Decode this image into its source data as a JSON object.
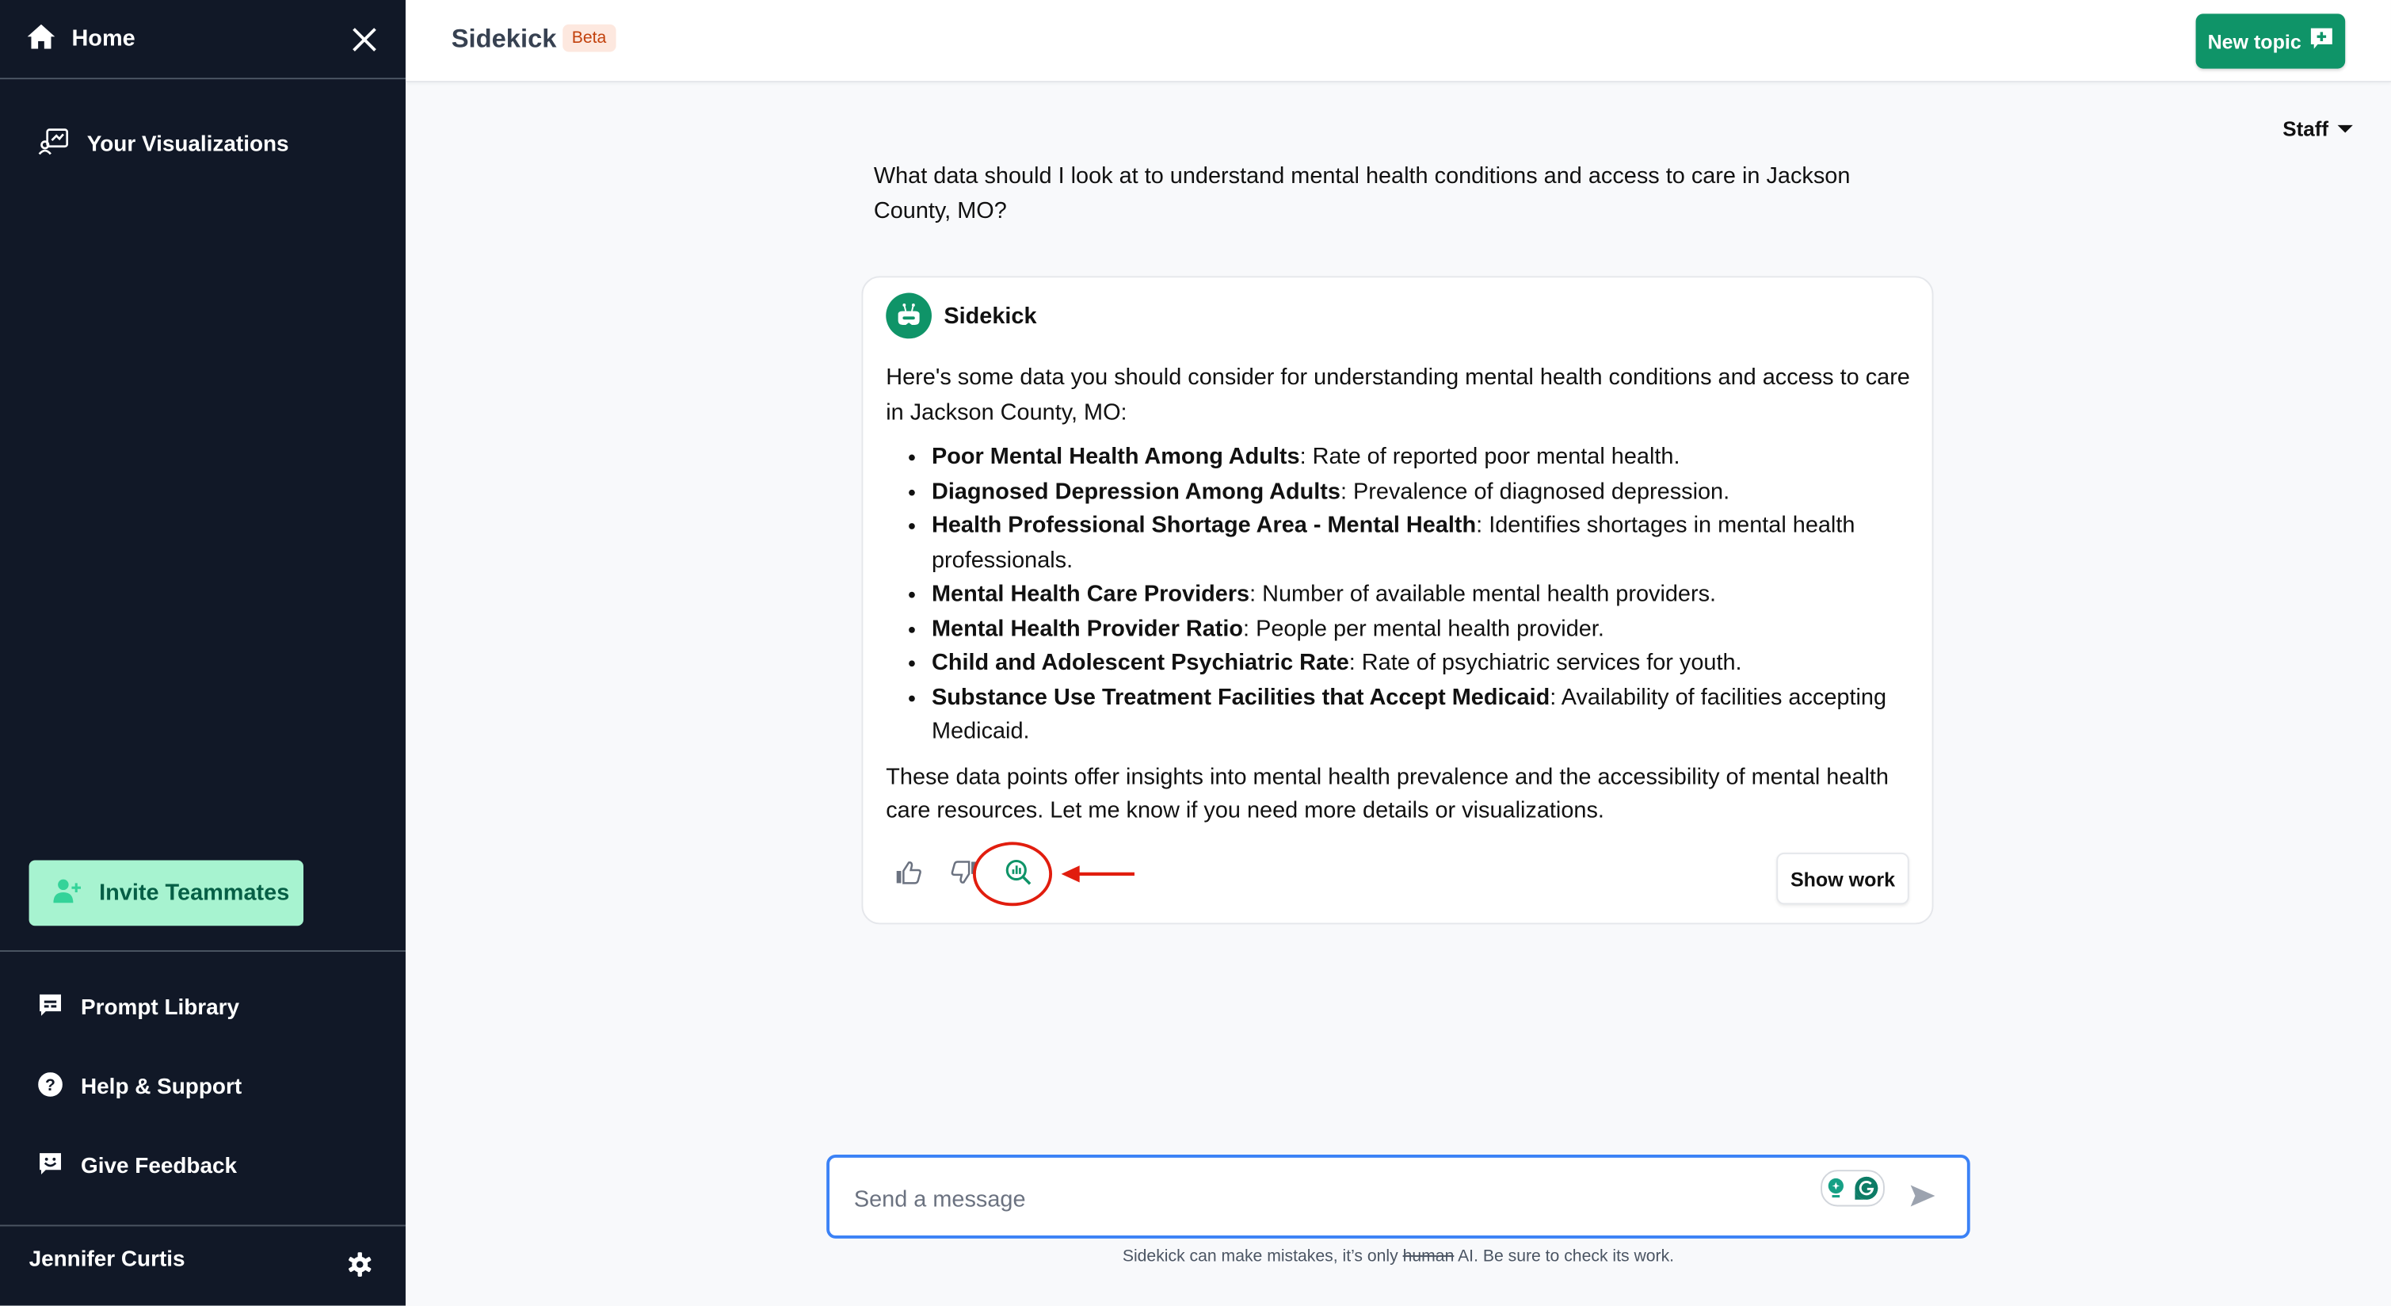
{
  "sidebar": {
    "home_label": "Home",
    "items": [
      {
        "label": "Your Visualizations",
        "icon": "visualizations-icon"
      }
    ],
    "invite_label": "Invite Teammates",
    "footer_items": [
      {
        "label": "Prompt Library",
        "icon": "prompt-library-icon"
      },
      {
        "label": "Help & Support",
        "icon": "help-icon"
      },
      {
        "label": "Give Feedback",
        "icon": "feedback-icon"
      }
    ],
    "user_name": "Jennifer Curtis"
  },
  "header": {
    "title": "Sidekick",
    "badge": "Beta",
    "new_topic_label": "New topic"
  },
  "role_selector": {
    "selected": "Staff"
  },
  "conversation": {
    "user_question": "What data should I look at to understand mental health conditions and access to care in Jackson County, MO?",
    "response": {
      "author": "Sidekick",
      "intro": "Here's some data you should consider for understanding mental health conditions and access to care in Jackson County, MO:",
      "items": [
        {
          "term": "Poor Mental Health Among Adults",
          "desc": ": Rate of reported poor mental health."
        },
        {
          "term": "Diagnosed Depression Among Adults",
          "desc": ": Prevalence of diagnosed depression."
        },
        {
          "term": "Health Professional Shortage Area - Mental Health",
          "desc": ": Identifies shortages in mental health professionals."
        },
        {
          "term": "Mental Health Care Providers",
          "desc": ": Number of available mental health providers."
        },
        {
          "term": "Mental Health Provider Ratio",
          "desc": ": People per mental health provider."
        },
        {
          "term": "Child and Adolescent Psychiatric Rate",
          "desc": ": Rate of psychiatric services for youth."
        },
        {
          "term": "Substance Use Treatment Facilities that Accept Medicaid",
          "desc": ": Availability of facilities accepting Medicaid."
        }
      ],
      "outro": "These data points offer insights into mental health prevalence and the accessibility of mental health care resources. Let me know if you need more details or visualizations.",
      "show_work_label": "Show work"
    }
  },
  "composer": {
    "placeholder": "Send a message",
    "value": "",
    "disclaimer_before": "Sidekick can make mistakes, it’s only ",
    "disclaimer_struck": "human",
    "disclaimer_after": " AI. Be sure to check its work."
  },
  "colors": {
    "sidebar_bg": "#111827",
    "brand_green": "#0f9468",
    "invite_bg": "#a7f3d0",
    "annotation_red": "#e11d0e",
    "input_focus": "#3b82f6"
  }
}
